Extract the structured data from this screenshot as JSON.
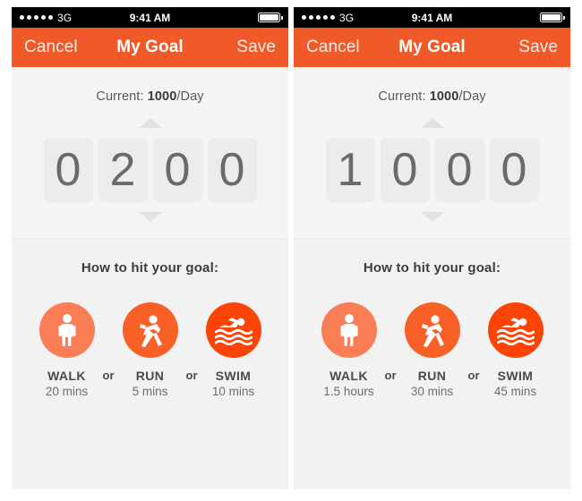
{
  "panels": [
    {
      "status_bar": {
        "signal_dots": 5,
        "carrier": "3G",
        "time": "9:41 AM",
        "battery_icon": "battery-full-icon"
      },
      "nav": {
        "cancel_label": "Cancel",
        "title": "My Goal",
        "save_label": "Save"
      },
      "goal": {
        "current_prefix": "Current: ",
        "current_value": "1000",
        "current_suffix": "/Day",
        "increment_icon": "triangle-up-icon",
        "decrement_icon": "triangle-down-icon",
        "digits": [
          "0",
          "2",
          "0",
          "0"
        ]
      },
      "howto": {
        "title": "How to hit your goal:",
        "separator": "or",
        "activities": [
          {
            "icon": "walk-icon",
            "name": "WALK",
            "duration": "20 mins",
            "color": "#fa7d55"
          },
          {
            "icon": "run-icon",
            "name": "RUN",
            "duration": "5 mins",
            "color": "#f96028"
          },
          {
            "icon": "swim-icon",
            "name": "SWIM",
            "duration": "10 mins",
            "color": "#fb4405"
          }
        ]
      }
    },
    {
      "status_bar": {
        "signal_dots": 5,
        "carrier": "3G",
        "time": "9:41 AM",
        "battery_icon": "battery-full-icon"
      },
      "nav": {
        "cancel_label": "Cancel",
        "title": "My Goal",
        "save_label": "Save"
      },
      "goal": {
        "current_prefix": "Current: ",
        "current_value": "1000",
        "current_suffix": "/Day",
        "increment_icon": "triangle-up-icon",
        "decrement_icon": "triangle-down-icon",
        "digits": [
          "1",
          "0",
          "0",
          "0"
        ]
      },
      "howto": {
        "title": "How to hit your goal:",
        "separator": "or",
        "activities": [
          {
            "icon": "walk-icon",
            "name": "WALK",
            "duration": "1.5 hours",
            "color": "#fa7d55"
          },
          {
            "icon": "run-icon",
            "name": "RUN",
            "duration": "30 mins",
            "color": "#f96028"
          },
          {
            "icon": "swim-icon",
            "name": "SWIM",
            "duration": "45 mins",
            "color": "#fb4405"
          }
        ]
      }
    }
  ],
  "theme": {
    "brand_orange": "#ef5a28",
    "status_bar_bg": "#000000",
    "goal_bg": "#f5f5f5",
    "howto_bg": "#f2f2f2",
    "digit_bg": "#ececec",
    "digit_text": "#6a6a6a"
  }
}
